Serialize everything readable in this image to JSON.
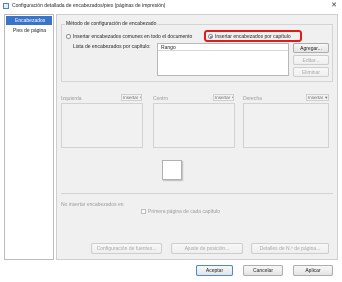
{
  "window": {
    "title": "Configuración detallada de encabezados/pies (páginas de impresión)",
    "accent": "#1f5fb3"
  },
  "sidebar": {
    "items": [
      {
        "label": "Encabezados"
      },
      {
        "label": "Pies de página"
      }
    ]
  },
  "method": {
    "group_title": "Método de configuración de encabezado",
    "option_common": "Insertar encabezados comunes en todo el documento",
    "option_chapter": "Insertar encabezados por capítulo",
    "highlight_color": "#e01b1b"
  },
  "list": {
    "label": "Lista de encabezados por capítulo:",
    "column_header": "Rango"
  },
  "list_buttons": {
    "add": "Agregar...",
    "edit": "Editar...",
    "delete": "Eliminar"
  },
  "sections": [
    {
      "label": "Izquierda",
      "dropdown": "Insertar"
    },
    {
      "label": "Centro",
      "dropdown": "Insertar"
    },
    {
      "label": "Derecha",
      "dropdown": "Insertar"
    }
  ],
  "no_insert": {
    "label": "No insertar encabezados en",
    "checkbox": "Primera página de cada capítulo"
  },
  "bottom_buttons": {
    "frame": "Configuración de fuentes...",
    "position": "Ajuste de posición...",
    "detail": "Detalles de N.º de página..."
  },
  "footer_buttons": {
    "ok": "Aceptar",
    "cancel": "Cancelar",
    "apply": "Aplicar"
  }
}
